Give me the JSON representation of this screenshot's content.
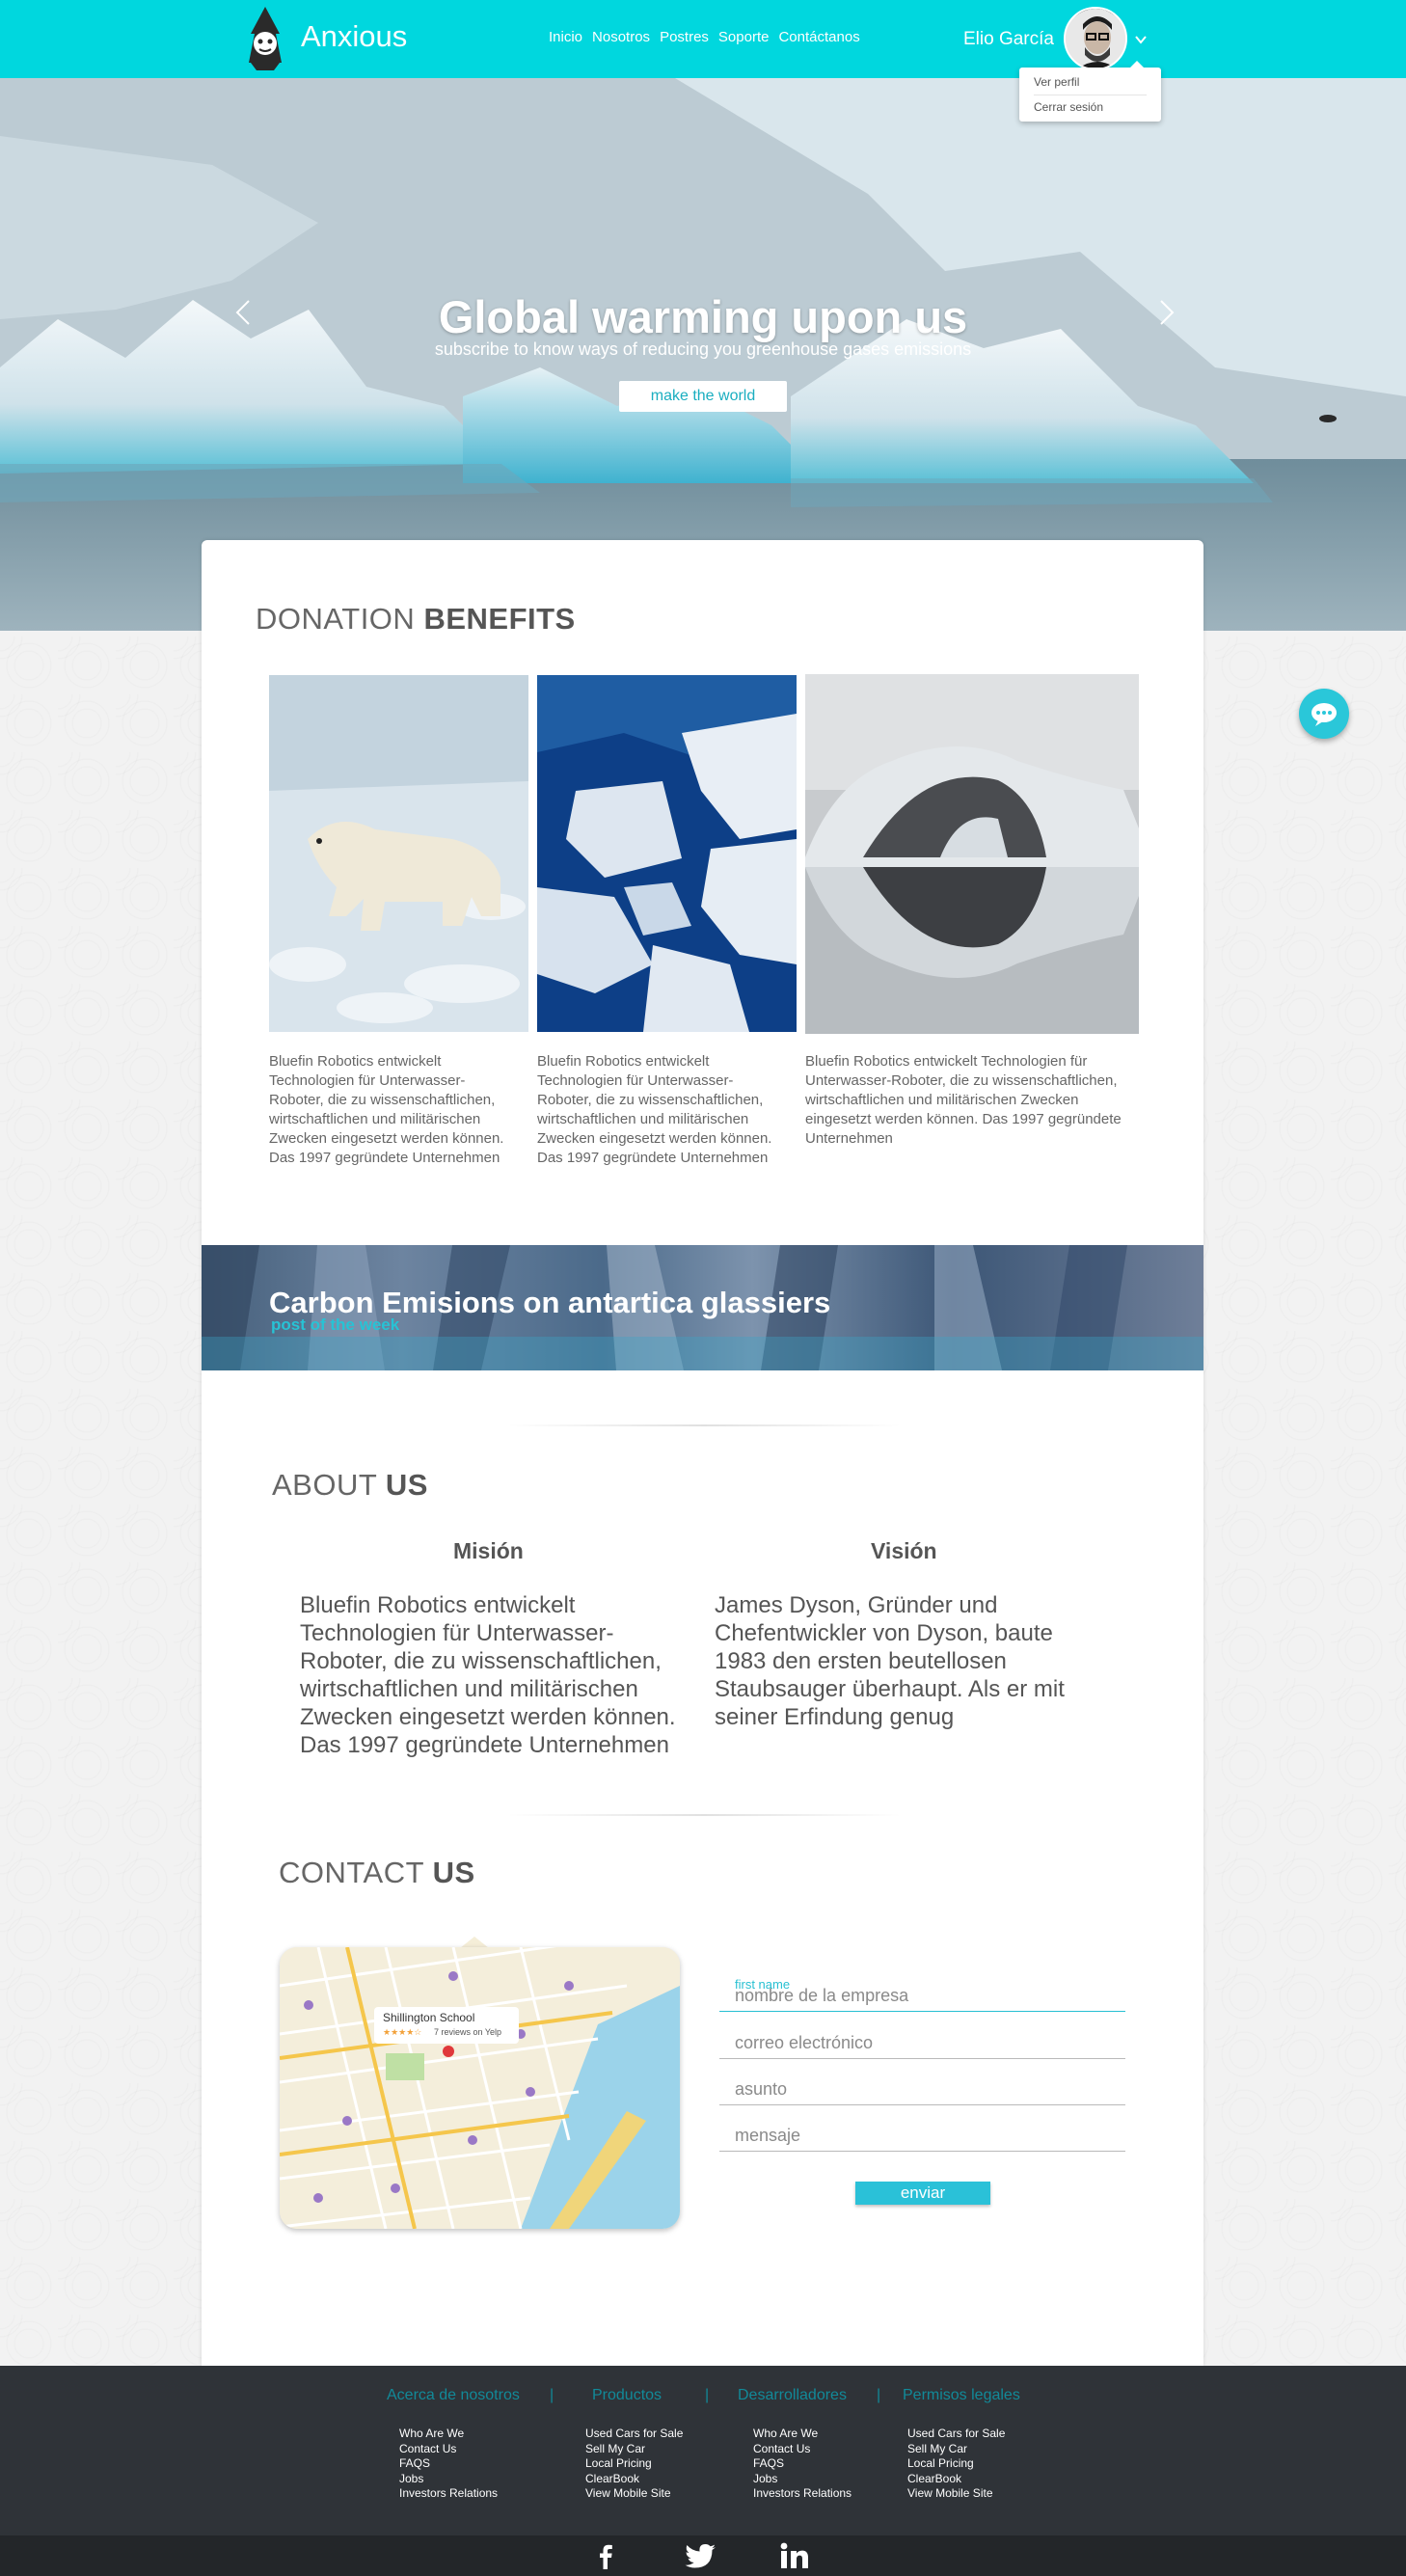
{
  "header": {
    "brand": "Anxious",
    "nav": [
      "Inicio",
      "Nosotros",
      "Postres",
      "Soporte",
      "Contáctanos"
    ],
    "user_name": "Elio García",
    "dropdown": [
      "Ver perfil",
      "Cerrar sesión"
    ]
  },
  "hero": {
    "title": "Global warming upon us",
    "subtitle": "subscribe to know ways of reducing you greenhouse gases emissions",
    "button": "make the world"
  },
  "benefits": {
    "title_light": "DONATION",
    "title_bold": "BENEFITS",
    "items": [
      {
        "text": "Bluefin Robotics entwickelt Technologien für Unterwasser-Roboter, die zu wissenschaftlichen, wirtschaftlichen und militärischen Zwecken eingesetzt werden können. Das 1997 gegründete Unternehmen"
      },
      {
        "text": "Bluefin Robotics entwickelt Technologien für Unterwasser-Roboter, die zu wissenschaftlichen, wirtschaftlichen und militärischen Zwecken eingesetzt werden können. Das 1997 gegründete Unternehmen"
      },
      {
        "text": "Bluefin Robotics entwickelt Technologien für Unterwasser-Roboter, die zu wissenschaftlichen, wirtschaftlichen und militärischen Zwecken eingesetzt werden können. Das 1997 gegründete Unternehmen"
      }
    ]
  },
  "banner": {
    "title": "Carbon Emisions on antartica glassiers",
    "subtitle": "post of the week"
  },
  "about": {
    "title_light": "ABOUT",
    "title_bold": "US",
    "mision": {
      "heading": "Misión",
      "text": "Bluefin Robotics entwickelt Technologien für Unterwasser-Roboter, die zu wissenschaftlichen, wirtschaftlichen und militärischen Zwecken eingesetzt werden können. Das 1997 gegründete Unternehmen"
    },
    "vision": {
      "heading": "Visión",
      "text": "James Dyson, Gründer und Chefentwickler von Dyson, baute 1983 den ersten beutellosen Staubsauger überhaupt. Als er mit seiner Erfindung genug"
    }
  },
  "contact": {
    "title_light": "CONTACT",
    "title_bold": "US",
    "map": {
      "place": "Shillington School",
      "reviews": "7 reviews on Yelp"
    },
    "active_label": "first name",
    "fields": [
      "nombre de la empresa",
      "correo electrónico",
      "asunto",
      "mensaje"
    ],
    "submit": "enviar"
  },
  "footer": {
    "columns": [
      {
        "heading": "Acerca de nosotros",
        "links": [
          "Who Are We",
          "Contact Us",
          "FAQS",
          "Jobs",
          "Investors Relations"
        ]
      },
      {
        "heading": "Productos",
        "links": [
          "Used Cars for Sale",
          "Sell My Car",
          "Local Pricing",
          "ClearBook",
          "View Mobile Site"
        ]
      },
      {
        "heading": "Desarrolladores",
        "links": [
          "Who Are We",
          "Contact Us",
          "FAQS",
          "Jobs",
          "Investors Relations"
        ]
      },
      {
        "heading": "Permisos legales",
        "links": [
          "Used Cars for Sale",
          "Sell My Car",
          "Local Pricing",
          "ClearBook",
          "View Mobile Site"
        ]
      }
    ],
    "social_icons": [
      "facebook-icon",
      "twitter-icon",
      "linkedin-icon"
    ]
  },
  "colors": {
    "accent": "#00d7de",
    "button_blue": "#2ac1d8",
    "footer_bg": "#2f3338",
    "footer_heading": "#118a99"
  }
}
